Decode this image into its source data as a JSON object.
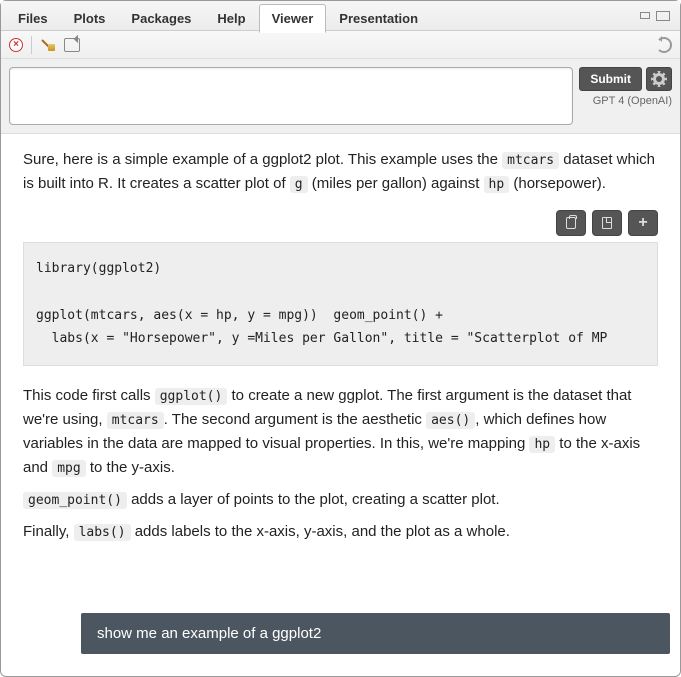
{
  "tabs": {
    "files": "Files",
    "plots": "Plots",
    "packages": "Packages",
    "help": "Help",
    "viewer": "Viewer",
    "presentation": "Presentation"
  },
  "toolbar": {
    "submit_label": "Submit",
    "model_label": "GPT 4 (OpenAI)",
    "input_value": ""
  },
  "response": {
    "p1a": "Sure, here is a simple example of a ggplot2 plot. This example uses the ",
    "p1_code1": "mtcars",
    "p1b": " dataset which is built into R. It creates a scatter plot of ",
    "p1_code2": "g",
    "p1c": " (miles per gallon) against ",
    "p1_code3": "hp",
    "p1d": " (horsepower).",
    "codeblock": "library(ggplot2)\n\nggplot(mtcars, aes(x = hp, y = mpg))  geom_point() +\n  labs(x = \"Horsepower\", y =Miles per Gallon\", title = \"Scatterplot of MP",
    "p2a": "This code first calls ",
    "p2_code1": "ggplot()",
    "p2b": " to create a new ggplot. The first argument is the dataset that we're using, ",
    "p2_code2": "mtcars",
    "p2c": ". The second argument is the aesthetic ",
    "p2_code3": "aes()",
    "p2d": ", which defines how variables in the data are mapped to visual properties. In this, we're mapping ",
    "p2_code4": "hp",
    "p2e": " to the x-axis and ",
    "p2_code5": "mpg",
    "p2f": " to the y-axis.",
    "p3_code1": "geom_point()",
    "p3a": " adds a layer of points to the plot, creating a scatter plot.",
    "p4a": "Finally, ",
    "p4_code1": "labs()",
    "p4b": " adds labels to the x-axis, y-axis, and the plot as a whole."
  },
  "user_message": "show me an example of a ggplot2"
}
